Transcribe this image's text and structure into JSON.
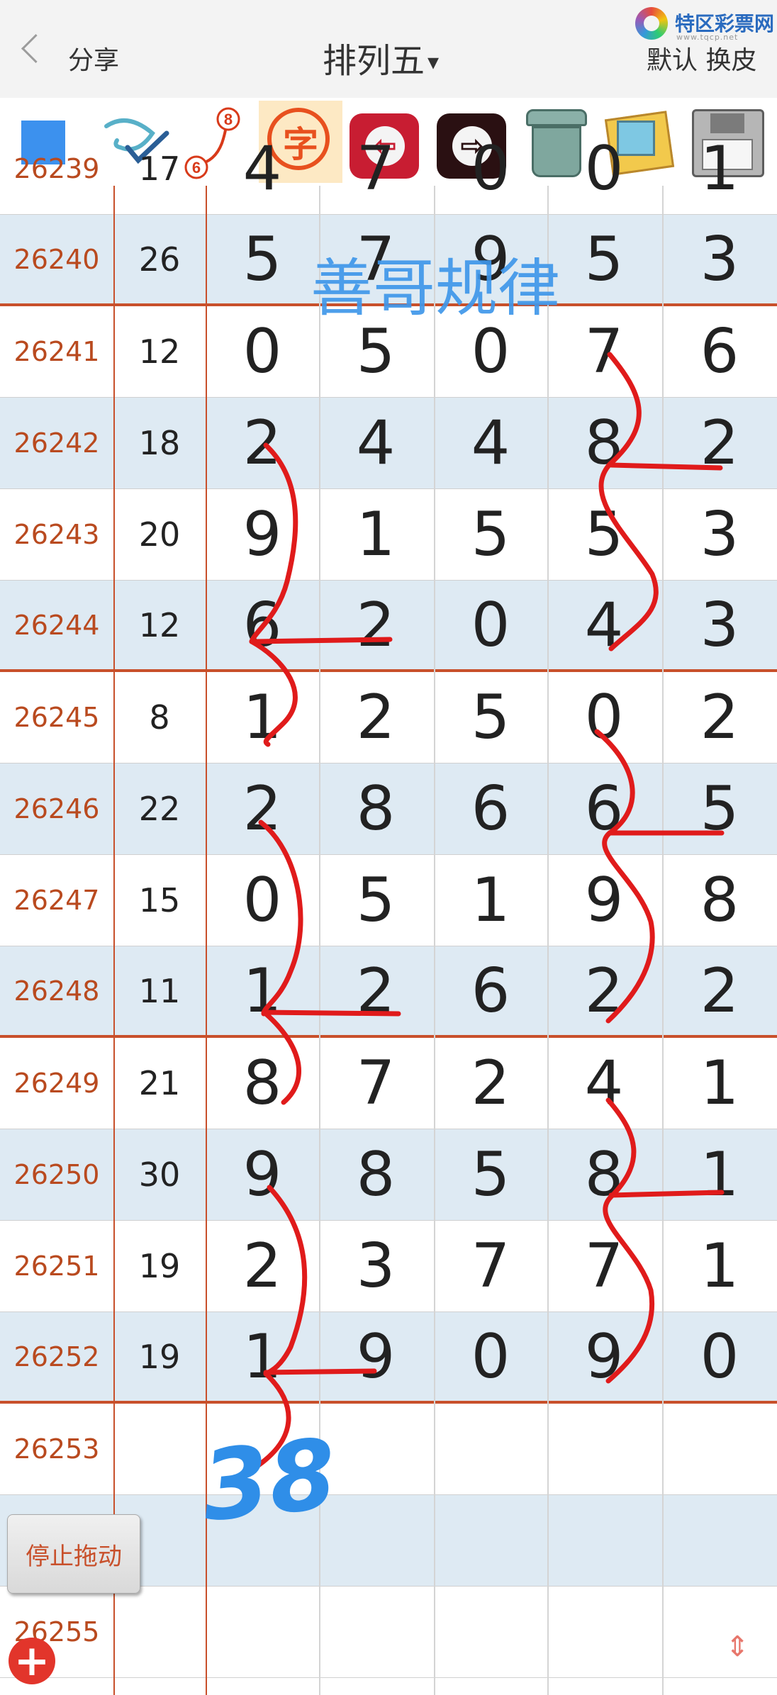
{
  "header": {
    "share_label": "分享",
    "title": "排列五",
    "title_caret": "▾",
    "logo_text": "特区彩票网",
    "logo_url": "www.tqcp.net",
    "default_label": "默认",
    "skin_label": "换皮"
  },
  "toolbar": {
    "char_label": "字",
    "badge_a": "8",
    "badge_b": "6",
    "back_glyph": "⇦",
    "forward_glyph": "⇨"
  },
  "table": {
    "partial_row": {
      "id": "26239",
      "sum": "17",
      "digits": [
        "4",
        "7",
        "0",
        "0",
        "1"
      ]
    },
    "rows": [
      {
        "id": "26240",
        "sum": "26",
        "digits": [
          "5",
          "7",
          "9",
          "5",
          "3"
        ]
      },
      {
        "id": "26241",
        "sum": "12",
        "digits": [
          "0",
          "5",
          "0",
          "7",
          "6"
        ]
      },
      {
        "id": "26242",
        "sum": "18",
        "digits": [
          "2",
          "4",
          "4",
          "8",
          "2"
        ]
      },
      {
        "id": "26243",
        "sum": "20",
        "digits": [
          "9",
          "1",
          "5",
          "5",
          "3"
        ]
      },
      {
        "id": "26244",
        "sum": "12",
        "digits": [
          "6",
          "2",
          "0",
          "4",
          "3"
        ]
      },
      {
        "id": "26245",
        "sum": "8",
        "digits": [
          "1",
          "2",
          "5",
          "0",
          "2"
        ]
      },
      {
        "id": "26246",
        "sum": "22",
        "digits": [
          "2",
          "8",
          "6",
          "6",
          "5"
        ]
      },
      {
        "id": "26247",
        "sum": "15",
        "digits": [
          "0",
          "5",
          "1",
          "9",
          "8"
        ]
      },
      {
        "id": "26248",
        "sum": "11",
        "digits": [
          "1",
          "2",
          "6",
          "2",
          "2"
        ]
      },
      {
        "id": "26249",
        "sum": "21",
        "digits": [
          "8",
          "7",
          "2",
          "4",
          "1"
        ]
      },
      {
        "id": "26250",
        "sum": "30",
        "digits": [
          "9",
          "8",
          "5",
          "8",
          "1"
        ]
      },
      {
        "id": "26251",
        "sum": "19",
        "digits": [
          "2",
          "3",
          "7",
          "7",
          "1"
        ]
      },
      {
        "id": "26252",
        "sum": "19",
        "digits": [
          "1",
          "9",
          "0",
          "9",
          "0"
        ]
      },
      {
        "id": "26253",
        "sum": "",
        "digits": [
          "",
          "",
          "",
          "",
          ""
        ]
      },
      {
        "id": "",
        "sum": "",
        "digits": [
          "",
          "",
          "",
          "",
          ""
        ]
      },
      {
        "id": "26255",
        "sum": "",
        "digits": [
          "",
          "",
          "",
          "",
          ""
        ]
      }
    ]
  },
  "overlay": {
    "watermark_text": "善哥规律",
    "handwritten_note": "38"
  },
  "controls": {
    "stop_drag_label": "停止拖动",
    "add_glyph": "+",
    "scroll_glyph": "⇕"
  },
  "colors": {
    "accent_blue": "#3c91ee",
    "issue_text": "#b94a1f",
    "row_alt": "#deeaf3",
    "group_separator": "#c8502b",
    "annotation_red": "#e01b1b"
  }
}
